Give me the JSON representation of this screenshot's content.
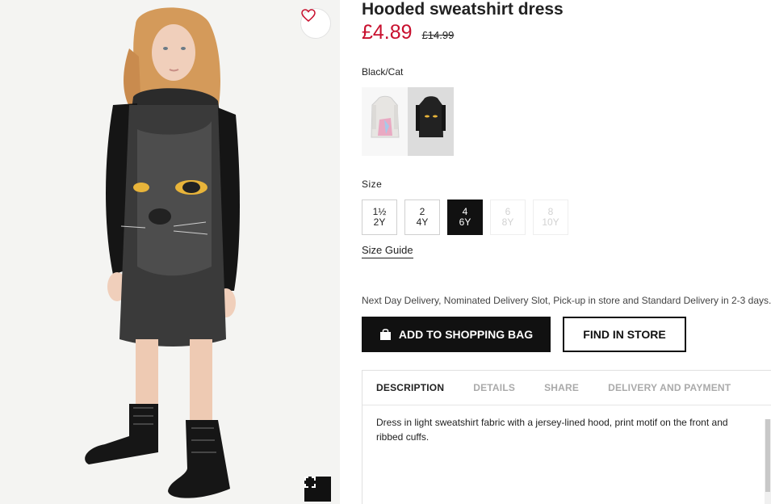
{
  "product": {
    "title": "Hooded sweatshirt dress",
    "price": "£4.89",
    "old_price": "£14.99"
  },
  "colour": {
    "selected_name": "Black/Cat",
    "swatches": [
      {
        "name": "light-grey-unicorn-swatch"
      },
      {
        "name": "black-cat-swatch",
        "selected": true
      }
    ]
  },
  "size": {
    "label": "Size",
    "options": [
      {
        "line1": "1½",
        "line2": "2Y",
        "state": "available"
      },
      {
        "line1": "2",
        "line2": "4Y",
        "state": "available"
      },
      {
        "line1": "4",
        "line2": "6Y",
        "state": "selected"
      },
      {
        "line1": "6",
        "line2": "8Y",
        "state": "disabled"
      },
      {
        "line1": "8",
        "line2": "10Y",
        "state": "disabled"
      }
    ],
    "guide_label": "Size Guide"
  },
  "delivery_note": "Next Day Delivery, Nominated Delivery Slot, Pick-up in store and Standard Delivery in 2-3 days.",
  "actions": {
    "add_to_bag": "ADD TO SHOPPING BAG",
    "find_in_store": "FIND IN STORE"
  },
  "info": {
    "tabs": [
      "DESCRIPTION",
      "DETAILS",
      "SHARE",
      "DELIVERY AND PAYMENT"
    ],
    "active_tab": "DESCRIPTION",
    "description": "Dress in light sweatshirt fabric with a jersey-lined hood, print motif on the front and ribbed cuffs."
  },
  "icons": {
    "favourite": "heart-icon",
    "fullscreen": "fullscreen-icon",
    "bag": "shopping-bag-icon"
  },
  "colors": {
    "price_red": "#c8102e",
    "primary_black": "#111111"
  }
}
